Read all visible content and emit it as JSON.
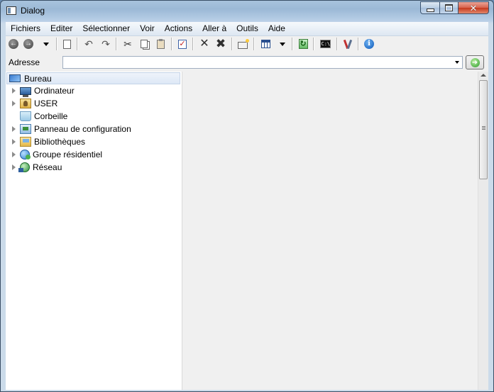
{
  "window": {
    "title": "Dialog"
  },
  "menu": [
    "Fichiers",
    "Editer",
    "Sélectionner",
    "Voir",
    "Actions",
    "Aller à",
    "Outils",
    "Aide"
  ],
  "address": {
    "label": "Adresse",
    "value": ""
  },
  "tree": {
    "root": "Bureau",
    "items": [
      {
        "label": "Ordinateur",
        "icon": "computer-icon",
        "expandable": true
      },
      {
        "label": "USER",
        "icon": "user-folder-icon",
        "expandable": true
      },
      {
        "label": "Corbeille",
        "icon": "recycle-bin-icon",
        "expandable": false
      },
      {
        "label": "Panneau de configuration",
        "icon": "control-panel-icon",
        "expandable": true
      },
      {
        "label": "Bibliothèques",
        "icon": "libraries-icon",
        "expandable": true
      },
      {
        "label": "Groupe résidentiel",
        "icon": "homegroup-icon",
        "expandable": true
      },
      {
        "label": "Réseau",
        "icon": "network-icon",
        "expandable": true
      }
    ]
  },
  "colors": {
    "close_button": "#c6381c",
    "tree_root_bg": "#dde8f6",
    "accent_blue": "#2a4f8f"
  }
}
